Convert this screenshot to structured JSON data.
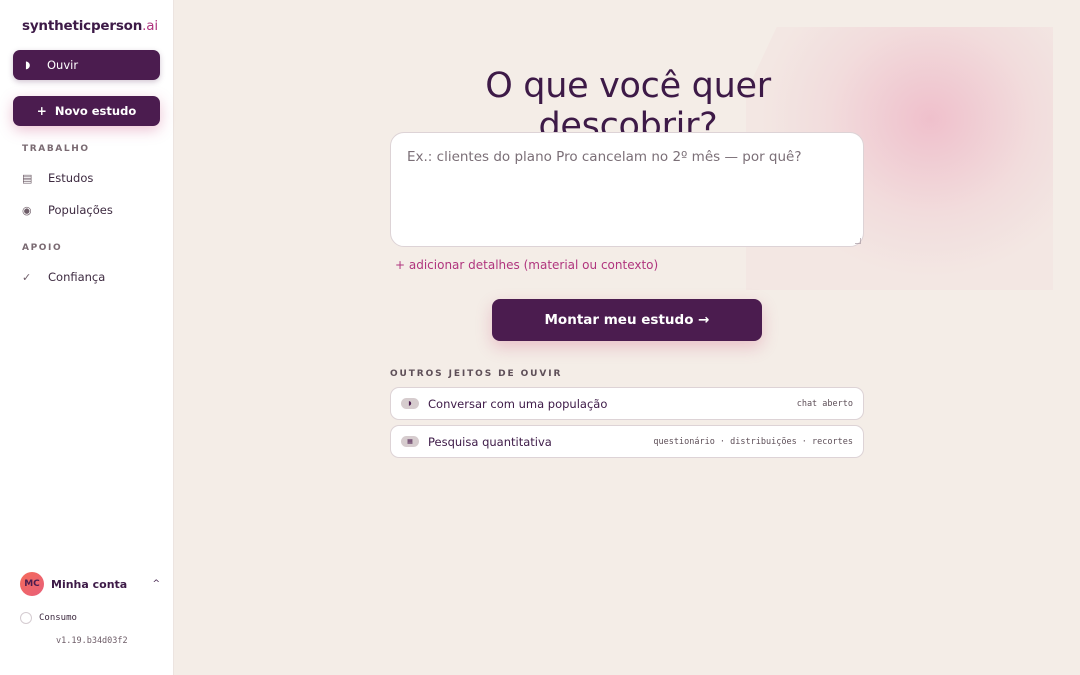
{
  "brand": {
    "name": "syntheticperson",
    "tld": ".ai"
  },
  "sidebar": {
    "primary": {
      "icon": "ear-icon",
      "label": "Ouvir"
    },
    "new_study": {
      "plus": "+",
      "label": "Novo estudo"
    },
    "sections": [
      {
        "label": "TRABALHO",
        "items": [
          {
            "icon": "list-icon",
            "glyph": "▤",
            "label": "Estudos"
          },
          {
            "icon": "population-icon",
            "glyph": "◉",
            "label": "Populações"
          }
        ]
      },
      {
        "label": "APOIO",
        "items": [
          {
            "icon": "check-icon",
            "glyph": "✓",
            "label": "Confiança"
          }
        ]
      }
    ],
    "account": {
      "initials": "MC",
      "label": "Minha conta",
      "chevron": "^"
    },
    "usage_label": "Consumo",
    "version": "v1.19.b34d03f2"
  },
  "main": {
    "title": "O que você quer descobrir?",
    "prompt_placeholder": "Ex.: clientes do plano Pro cancelam no 2º mês — por quê?",
    "add_details": "+ adicionar detalhes (material ou contexto)",
    "cta": "Montar meu estudo →",
    "others_label": "OUTROS JEITOS DE OUVIR",
    "options": [
      {
        "icon": "chat-icon",
        "glyph": "◗",
        "label": "Conversar com uma população",
        "meta": "chat aberto"
      },
      {
        "icon": "survey-icon",
        "glyph": "▦",
        "label": "Pesquisa quantitativa",
        "meta": "questionário · distribuições · recortes"
      }
    ]
  },
  "colors": {
    "brand": "#4b1c4f",
    "accent": "#b0357e",
    "background": "#f4ede7"
  }
}
